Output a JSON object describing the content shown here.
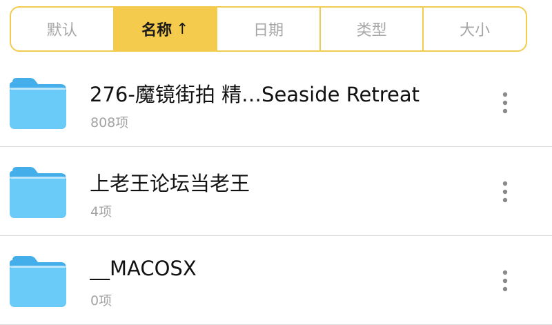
{
  "colors": {
    "accent": "#F4CB4C",
    "accent_border": "#F2CC50",
    "folder": "#6BCBF8",
    "folder_tab": "#43AEEA"
  },
  "sort_tabs": [
    {
      "label": "默认",
      "active": false
    },
    {
      "label": "名称",
      "active": true,
      "arrow": "↑"
    },
    {
      "label": "日期",
      "active": false
    },
    {
      "label": "类型",
      "active": false
    },
    {
      "label": "大小",
      "active": false
    }
  ],
  "files": [
    {
      "name": "276-魔镜街拍 精…Seaside Retreat",
      "meta": "808项",
      "icon": "folder-icon"
    },
    {
      "name": "上老王论坛当老王",
      "meta": "4项",
      "icon": "folder-icon"
    },
    {
      "name": "__MACOSX",
      "meta": "0项",
      "icon": "folder-icon"
    }
  ],
  "row_action_icon": "more-vertical-icon"
}
